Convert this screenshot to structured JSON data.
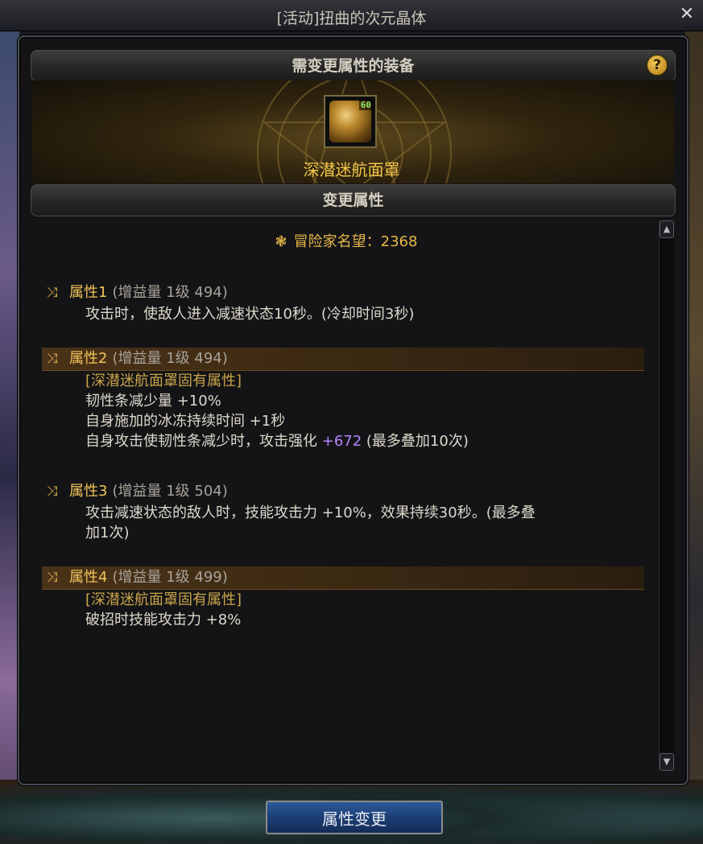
{
  "window": {
    "title": "[活动]扭曲的次元晶体",
    "close_symbol": "✕"
  },
  "equipment_section": {
    "header": "需变更属性的装备",
    "help_symbol": "?",
    "item": {
      "name": "深潜迷航面罩",
      "level": "60",
      "icon": "mask-icon"
    }
  },
  "attribute_section": {
    "header": "变更属性",
    "reputation": {
      "label": "冒险家名望",
      "separator": "：",
      "value": "2368",
      "icon": "reputation-icon"
    },
    "attributes": [
      {
        "title": "属性1",
        "sub": "(增益量 1级 494)",
        "highlighted": false,
        "lines": [
          "攻击时，使敌人进入减速状态10秒。(冷却时间3秒)"
        ]
      },
      {
        "title": "属性2",
        "sub": "(增益量 1级 494)",
        "highlighted": true,
        "tag": "[深潜迷航面罩固有属性]",
        "lines": [
          "韧性条减少量 +10%",
          "自身施加的冰冻持续时间 +1秒"
        ],
        "special_line": {
          "before": "自身攻击使韧性条减少时，攻击强化 ",
          "highlight": "+672",
          "after": " (最多叠加10次)"
        }
      },
      {
        "title": "属性3",
        "sub": "(增益量 1级 504)",
        "highlighted": false,
        "lines": [
          "攻击减速状态的敌人时，技能攻击力 +10%，效果持续30秒。(最多叠",
          "加1次)"
        ]
      },
      {
        "title": "属性4",
        "sub": "(增益量 1级 499)",
        "highlighted": true,
        "tag": "[深潜迷航面罩固有属性]",
        "lines": [
          "破招时技能攻击力 +8%"
        ]
      }
    ],
    "shuffle_symbol": "⤨"
  },
  "scrollbar": {
    "up_symbol": "▲",
    "down_symbol": "▼"
  },
  "actions": {
    "change_button_label": "属性变更"
  },
  "colors": {
    "gold": "#f0c45a",
    "purple_value": "#b484ff",
    "tag": "#c9a44a",
    "button_blue": "#1c3e74"
  }
}
